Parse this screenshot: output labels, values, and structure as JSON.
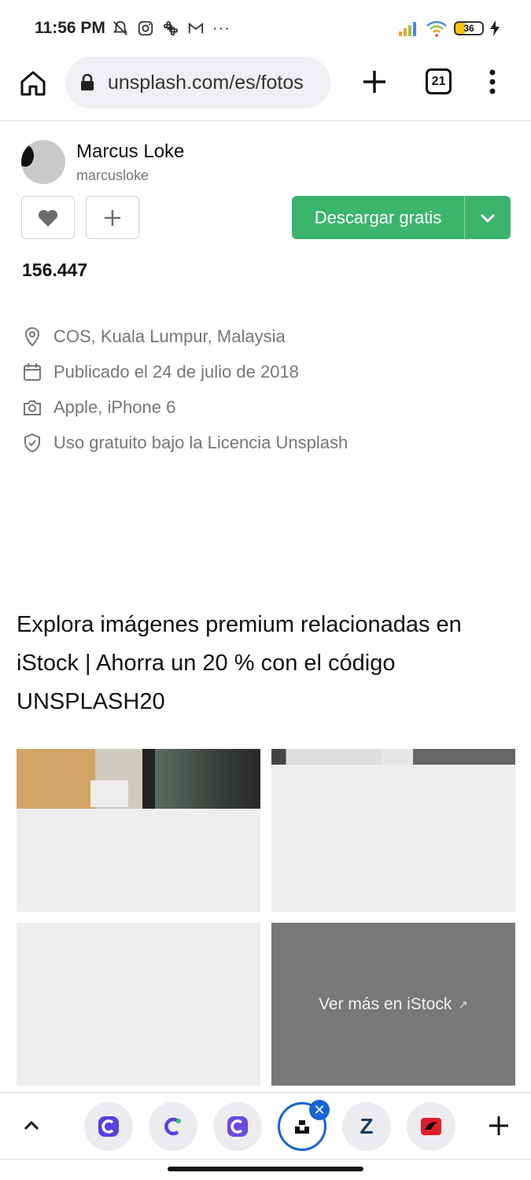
{
  "status_bar": {
    "time": "11:56 PM",
    "dots": "···",
    "battery": "36"
  },
  "browser": {
    "url": "unsplash.com/es/fotos",
    "tab_count": "21"
  },
  "author": {
    "name": "Marcus Loke",
    "username": "marcusloke"
  },
  "actions": {
    "download_label": "Descargar gratis"
  },
  "stats": {
    "views": "156.447"
  },
  "info": {
    "location": "COS, Kuala Lumpur, Malaysia",
    "published": "Publicado el 24 de julio de 2018",
    "camera": "Apple, iPhone 6",
    "license": "Uso gratuito bajo la Licencia Unsplash"
  },
  "promo": {
    "text": "Explora imágenes premium relacionadas en iStock | Ahorra un 20 % con el código UNSPLASH20"
  },
  "grid": {
    "more_label": "Ver más en iStock",
    "more_arrow": "↗"
  },
  "bottom_tabs": {
    "active_close": "✕",
    "tab_icons": [
      "c-app-icon",
      "c-app-icon",
      "c-app-icon",
      "unsplash-icon",
      "z-app-icon",
      "red-app-icon"
    ],
    "z_letter": "Z"
  },
  "colors": {
    "accent_green": "#3cb46e",
    "active_tab_blue": "#1a63d4"
  }
}
